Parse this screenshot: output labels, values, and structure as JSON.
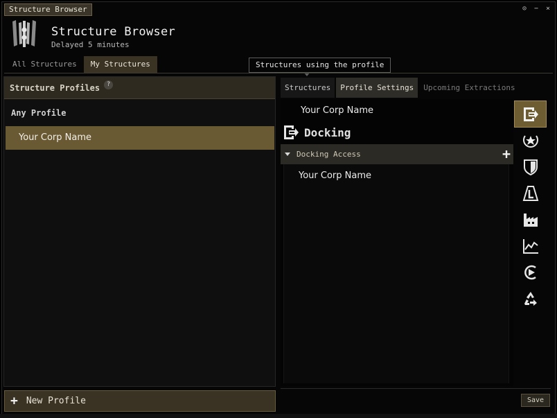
{
  "window": {
    "title": "Structure Browser",
    "controls": [
      "⊙",
      "−",
      "×"
    ]
  },
  "header": {
    "title": "Structure Browser",
    "subtitle": "Delayed 5 minutes"
  },
  "main_tabs": [
    {
      "label": "All Structures",
      "active": false
    },
    {
      "label": "My Structures",
      "active": true
    }
  ],
  "tooltip": "Structures using the profile",
  "left_panel": {
    "header": "Structure Profiles",
    "help": "?",
    "any_profile": "Any Profile",
    "selected_profile": "Your Corp Name",
    "new_profile_label": "New Profile"
  },
  "sub_tabs": [
    {
      "label": "Structures",
      "state": "normal"
    },
    {
      "label": "Profile Settings",
      "state": "active"
    },
    {
      "label": "Upcoming Extractions",
      "state": "dim"
    }
  ],
  "settings": {
    "profile_name": "Your Corp Name",
    "section_title": "Docking",
    "access_header": "Docking Access",
    "access_items": [
      "Your Corp Name"
    ]
  },
  "side_icons": [
    "docking-icon",
    "medal-star-icon",
    "shield-icon",
    "tower-icon",
    "factory-icon",
    "market-chart-icon",
    "jump-gate-icon",
    "recycle-icon"
  ],
  "save_label": "Save",
  "colors": {
    "accent": "#6e5c33",
    "selected_row": "#6a5a34",
    "header_bar": "#2f2a1f"
  }
}
